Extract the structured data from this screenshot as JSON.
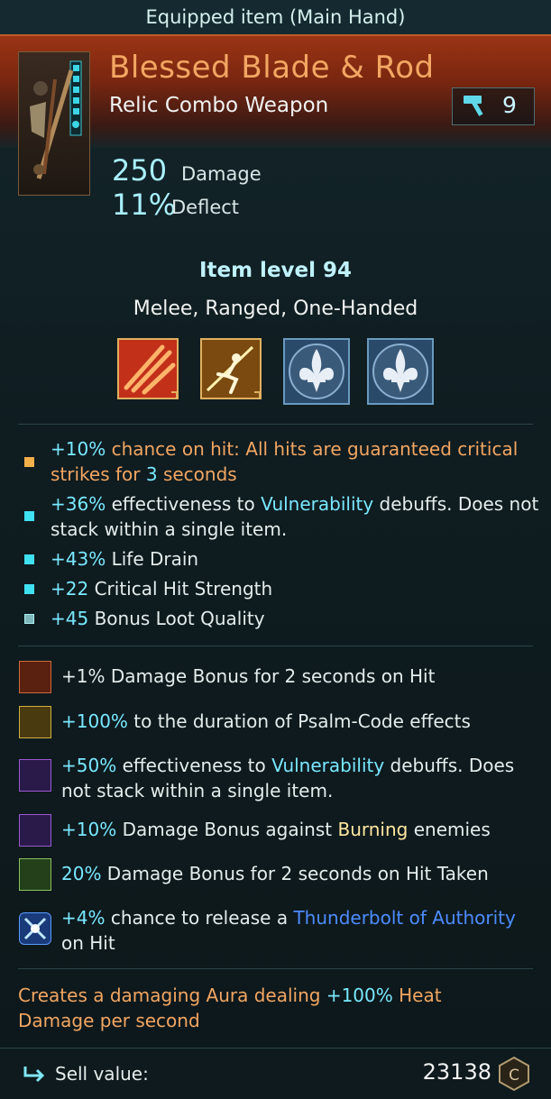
{
  "top_bar": {
    "title": "Equipped item (Main Hand)"
  },
  "item": {
    "name": "Blessed Blade & Rod",
    "type": "Relic Combo Weapon",
    "upgrade_level": "9"
  },
  "stats": {
    "damage_value": "250",
    "damage_label": "Damage",
    "deflect_value": "11%",
    "deflect_label": "Deflect"
  },
  "item_level": "Item level 94",
  "tags": "Melee, Ranged, One-Handed",
  "abilities": [
    "fire-slash-ability-icon",
    "dash-strike-ability-icon",
    "fleur-de-lis-ability-icon",
    "fleur-de-lis-ability-icon"
  ],
  "modifiers": [
    {
      "parts": [
        "+10%",
        " chance on hit: All hits are guaranteed ",
        "critical strikes for ",
        "3",
        " seconds"
      ]
    },
    {
      "parts": [
        "+36%",
        " effectiveness to ",
        "Vulnerability",
        " debuffs. Does not stack within a single item."
      ]
    },
    {
      "parts": [
        "+43%",
        " Life Drain"
      ]
    },
    {
      "parts": [
        "+22",
        " Critical Hit Strength"
      ]
    },
    {
      "parts": [
        "+45",
        " Bonus Loot Quality"
      ]
    }
  ],
  "psalm_codes": [
    {
      "parts": [
        "+1% Damage Bonus for 2 seconds on Hit"
      ]
    },
    {
      "parts": [
        "+100%",
        " to the duration of Psalm-Code effects"
      ]
    },
    {
      "parts": [
        "+50%",
        " effectiveness to ",
        "Vulnerability",
        " debuffs. Does not stack within a single item."
      ]
    },
    {
      "parts": [
        "+10%",
        " Damage Bonus against ",
        "Burning",
        " enemies"
      ]
    },
    {
      "parts": [
        "20%",
        " Damage Bonus for 2 seconds on Hit Taken"
      ]
    },
    {
      "parts": [
        "+4%",
        " chance to release a ",
        "Thunderbolt of Authority",
        " on Hit"
      ]
    }
  ],
  "aura": {
    "parts": [
      "Creates a damaging Aura dealing ",
      "+100%",
      " Heat Damage per second"
    ]
  },
  "sell": {
    "label": "Sell value:",
    "value": "23138"
  },
  "colors": {
    "accent_gold": "#f2a662",
    "accent_cyan": "#79e8ff",
    "link_blue": "#4d8cff"
  }
}
